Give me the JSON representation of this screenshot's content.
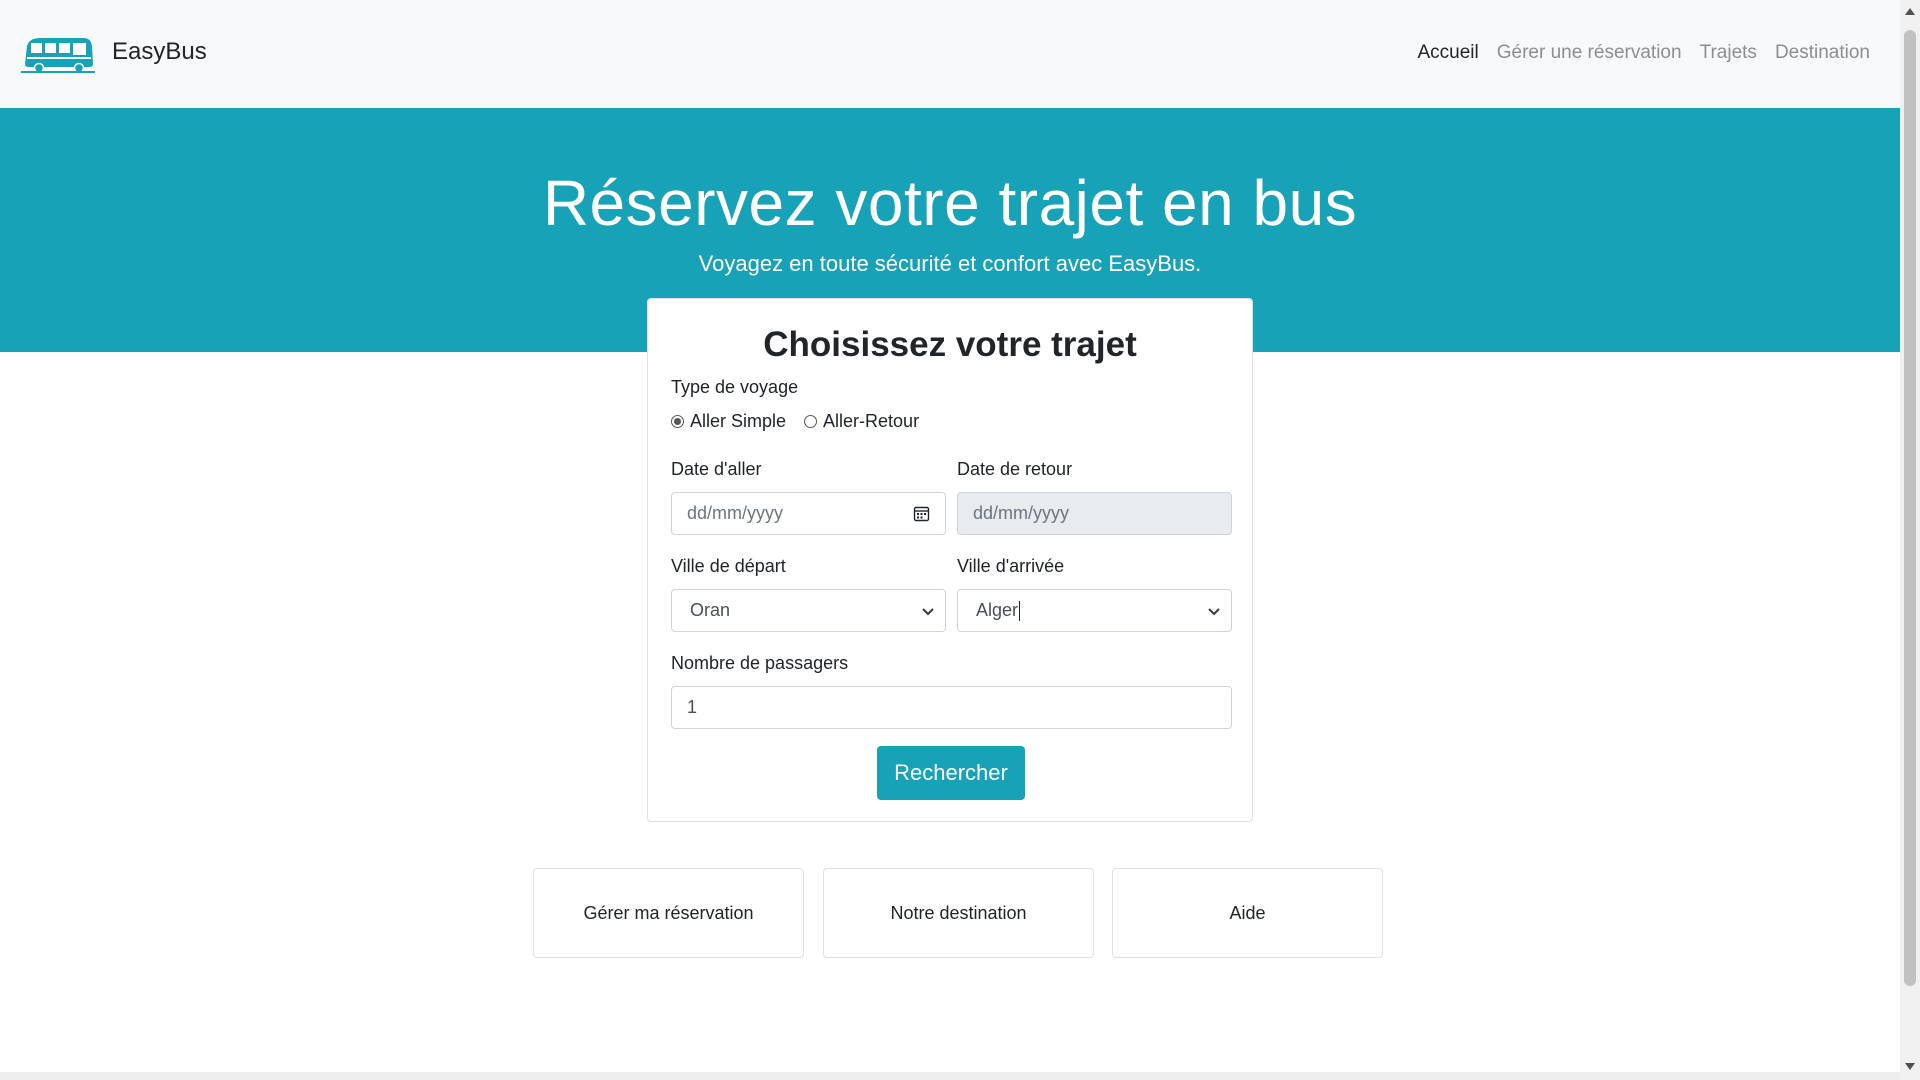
{
  "nav": {
    "brand": "EasyBus",
    "links": [
      "Accueil",
      "Gérer une réservation",
      "Trajets",
      "Destination"
    ]
  },
  "hero": {
    "title": "Réservez votre trajet en bus",
    "subtitle": "Voyagez en toute sécurité et confort avec EasyBus."
  },
  "form": {
    "title": "Choisissez votre trajet",
    "trip_type_label": "Type de voyage",
    "trip_types": [
      "Aller Simple",
      "Aller-Retour"
    ],
    "selected_trip_type": "Aller Simple",
    "depart_date_label": "Date d'aller",
    "depart_date_placeholder": "dd/mm/yyyy",
    "return_date_label": "Date de retour",
    "return_date_placeholder": "dd/mm/yyyy",
    "from_label": "Ville de départ",
    "from_value": "Oran",
    "to_label": "Ville d'arrivée",
    "to_value": "Alger",
    "passengers_label": "Nombre de passagers",
    "passengers_value": "1",
    "search_button": "Rechercher"
  },
  "tiles": [
    "Gérer ma réservation",
    "Notre destination",
    "Aide"
  ],
  "colors": {
    "accent": "#17a2b8",
    "navbar_bg": "#f8f9fa"
  }
}
